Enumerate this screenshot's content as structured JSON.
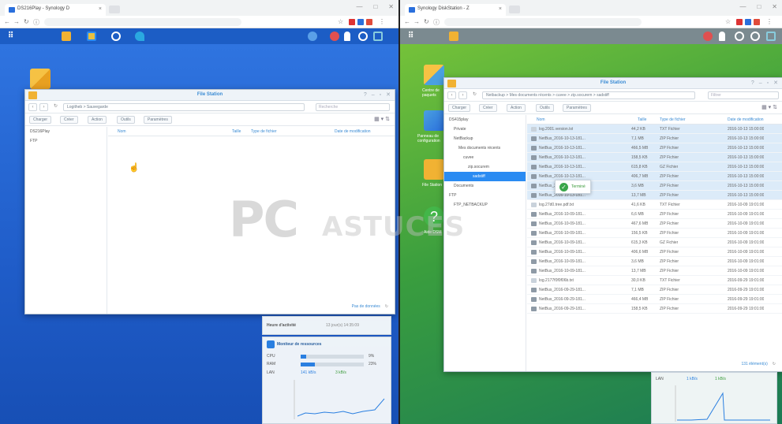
{
  "left": {
    "tab_title": "DS216Play - Synology D",
    "dsm_title": "File Station",
    "path": "Logitheb > Sauvegarde",
    "search_placeholder": "Recherche",
    "toolbar": [
      "Charger",
      "Créer",
      "Action",
      "Outils",
      "Paramètres"
    ],
    "tree": [
      "DS216Play",
      "FTP"
    ],
    "columns": [
      "Nom",
      "Taille",
      "Type de fichier",
      "Date de modification"
    ],
    "footer": "Pas de données",
    "widget_time_label": "Heure d'activité",
    "widget_time_value": "13 jour(s) 14:35:09",
    "monitor_title": "Moniteur de ressources",
    "cpu_label": "CPU",
    "cpu_value": "9%",
    "cpu_pct": 9,
    "ram_label": "RAM",
    "ram_value": "23%",
    "ram_pct": 23,
    "lan_label": "LAN",
    "lan_down": "141 kB/s",
    "lan_up": "3 kB/s"
  },
  "right": {
    "tab_title": "Synology DiskStation - Z",
    "dsm_title": "File Station",
    "path": "Netbackup > Mes documents récents > cuvee > zip.socurem > sadstiff",
    "search_placeholder": "Filtrer",
    "toolbar": [
      "Charger",
      "Créer",
      "Action",
      "Outils",
      "Paramètres"
    ],
    "tree": [
      "DS415play",
      "Private",
      "NetBackup",
      "Mes documents récents",
      "cuvee",
      "zip.socurem",
      "sadstiff",
      "Documents",
      "FTP",
      "FTP_NETBACKUP"
    ],
    "columns": [
      "Nom",
      "Taille",
      "Type de fichier",
      "Date de modification"
    ],
    "toast": "Terminé",
    "footer": "131 élément(s)",
    "lan_label": "LAN",
    "lan_down": "1 kB/s",
    "lan_up": "1 kB/s",
    "rows": [
      {
        "name": "log.2001.version.txt",
        "size": "44,2 KB",
        "type": "TXT Fichier",
        "date": "2016-10-13 15:00:00",
        "sel": true
      },
      {
        "name": "NetBus_2016-10-13-181...",
        "size": "7,1 MB",
        "type": "ZIP Fichier",
        "date": "2016-10-13 15:00:00",
        "sel": true
      },
      {
        "name": "NetBus_2016-10-13-181...",
        "size": "466,5 MB",
        "type": "ZIP Fichier",
        "date": "2016-10-13 15:00:00",
        "sel": true
      },
      {
        "name": "NetBus_2016-10-13-181...",
        "size": "158,5 KB",
        "type": "ZIP Fichier",
        "date": "2016-10-13 15:00:00",
        "sel": true
      },
      {
        "name": "NetBus_2016-10-13-181...",
        "size": "615,8 KB",
        "type": "GZ Fichier",
        "date": "2016-10-13 15:00:00",
        "sel": true
      },
      {
        "name": "NetBus_2016-10-13-181...",
        "size": "406,7 MB",
        "type": "ZIP Fichier",
        "date": "2016-10-13 15:00:00",
        "sel": true
      },
      {
        "name": "NetBus_2016-10-13-181...",
        "size": "3,6 MB",
        "type": "ZIP Fichier",
        "date": "2016-10-13 15:00:00",
        "sel": true
      },
      {
        "name": "NetBus_2016-10-13-181...",
        "size": "13,7 MB",
        "type": "ZIP Fichier",
        "date": "2016-10-13 15:00:00",
        "sel": true
      },
      {
        "name": "log.27d0.tree.pdf.txt",
        "size": "41,6 KB",
        "type": "TXT Fichier",
        "date": "2016-10-09 19:01:00",
        "sel": false
      },
      {
        "name": "NetBus_2016-10-09-181...",
        "size": "6,6 MB",
        "type": "ZIP Fichier",
        "date": "2016-10-09 19:01:00",
        "sel": false
      },
      {
        "name": "NetBus_2016-10-09-181...",
        "size": "467,6 MB",
        "type": "ZIP Fichier",
        "date": "2016-10-09 19:01:00",
        "sel": false
      },
      {
        "name": "NetBus_2016-10-09-181...",
        "size": "156,5 KB",
        "type": "ZIP Fichier",
        "date": "2016-10-09 19:01:00",
        "sel": false
      },
      {
        "name": "NetBus_2016-10-09-181...",
        "size": "615,3 KB",
        "type": "GZ Fichier",
        "date": "2016-10-09 19:01:00",
        "sel": false
      },
      {
        "name": "NetBus_2016-10-09-181...",
        "size": "406,6 MB",
        "type": "ZIP Fichier",
        "date": "2016-10-09 19:01:00",
        "sel": false
      },
      {
        "name": "NetBus_2016-10-09-181...",
        "size": "3,6 MB",
        "type": "ZIP Fichier",
        "date": "2016-10-09 19:01:00",
        "sel": false
      },
      {
        "name": "NetBus_2016-10-09-181...",
        "size": "13,7 MB",
        "type": "ZIP Fichier",
        "date": "2016-10-09 19:01:00",
        "sel": false
      },
      {
        "name": "log.2177f0f0f06b.txt",
        "size": "30,0 KB",
        "type": "TXT Fichier",
        "date": "2016-09-29 19:01:00",
        "sel": false
      },
      {
        "name": "NetBus_2016-09-29-181...",
        "size": "7,1 MB",
        "type": "ZIP Fichier",
        "date": "2016-09-29 19:01:00",
        "sel": false
      },
      {
        "name": "NetBus_2016-09-29-181...",
        "size": "466,4 MB",
        "type": "ZIP Fichier",
        "date": "2016-09-29 19:01:00",
        "sel": false
      },
      {
        "name": "NetBus_2016-09-29-181...",
        "size": "158,5 KB",
        "type": "ZIP Fichier",
        "date": "2016-09-29 19:01:00",
        "sel": false
      }
    ]
  },
  "watermark_big": "PC",
  "watermark_small": "ASTUCES",
  "desktop_labels": {
    "right_top": "Centre de paquets",
    "right_mid": "Panneau de configuration",
    "right_low": "File Station",
    "right_help": "Aide DSM"
  }
}
